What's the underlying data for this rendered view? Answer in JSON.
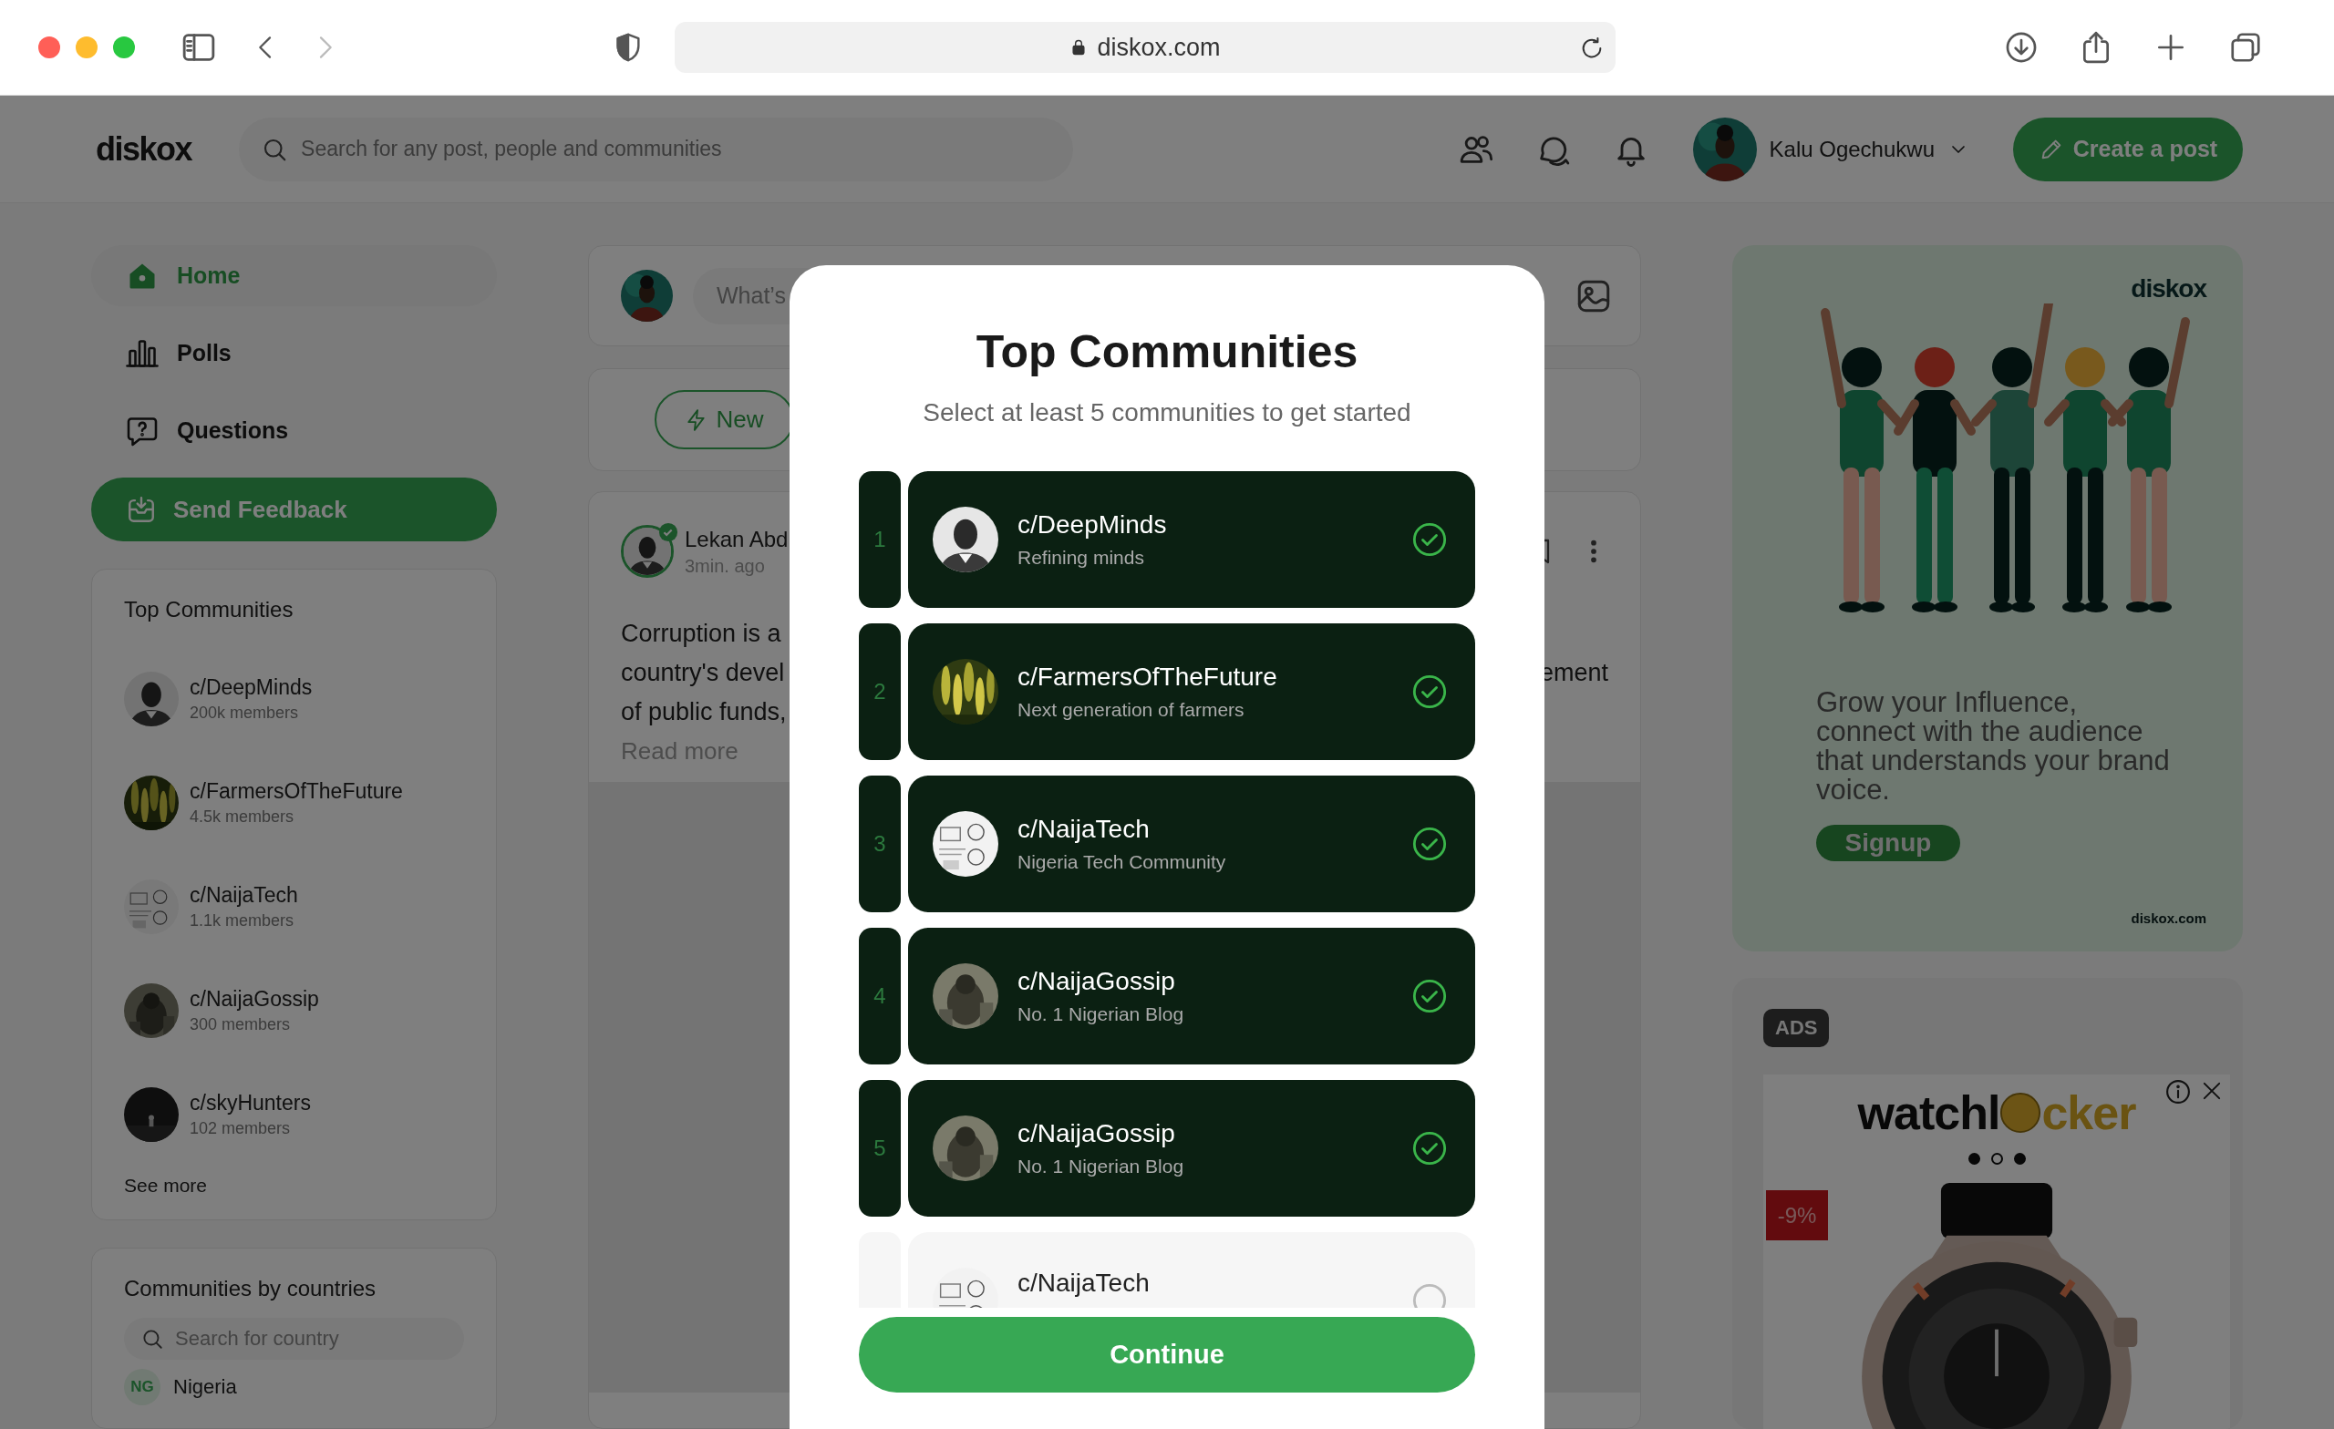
{
  "browser": {
    "url": "diskox.com"
  },
  "header": {
    "logo": "diskox",
    "search_placeholder": "Search for any post, people and communities",
    "user_name": "Kalu Ogechukwu",
    "create_button": "Create a post"
  },
  "sidebar": {
    "nav": [
      {
        "label": "Home",
        "selected": true
      },
      {
        "label": "Polls",
        "selected": false
      },
      {
        "label": "Questions",
        "selected": false
      }
    ],
    "feedback_button": "Send Feedback",
    "top_communities": {
      "title": "Top Communities",
      "items": [
        {
          "name": "c/DeepMinds",
          "members": "200k members"
        },
        {
          "name": "c/FarmersOfTheFuture",
          "members": "4.5k members"
        },
        {
          "name": "c/NaijaTech",
          "members": "1.1k members"
        },
        {
          "name": "c/NaijaGossip",
          "members": "300 members"
        },
        {
          "name": "c/skyHunters",
          "members": "102 members"
        }
      ],
      "see_more": "See more"
    },
    "countries": {
      "title": "Communities by countries",
      "search_placeholder": "Search for country",
      "items": [
        {
          "code": "NG",
          "name": "Nigeria"
        }
      ]
    }
  },
  "feed": {
    "composer_placeholder": "What’s",
    "filter_button": "New",
    "post": {
      "author": "Lekan Abd",
      "time": "3min. ago",
      "verified": true,
      "lines": [
        {
          "left": "Corruption is a"
        },
        {
          "left": "country's devel",
          "right": "ement"
        },
        {
          "left": "of public funds,"
        }
      ],
      "read_more": "Read more"
    }
  },
  "right": {
    "promo": {
      "logo": "diskox",
      "text": "Grow your Influence, connect with the audience that understands your brand voice.",
      "button": "Signup",
      "site": "diskox.com"
    },
    "ads": {
      "badge": "ADS",
      "logo_left": "watchl",
      "logo_right": "cker",
      "dots": [
        {
          "selected": false
        },
        {
          "selected": true
        },
        {
          "selected": false
        }
      ],
      "discount": "-9%"
    }
  },
  "modal": {
    "title": "Top Communities",
    "subtitle": "Select at least 5 communities to get started",
    "items": [
      {
        "number": "1",
        "name": "c/DeepMinds",
        "description": "Refining minds",
        "selected": true
      },
      {
        "number": "2",
        "name": "c/FarmersOfTheFuture",
        "description": "Next generation of farmers",
        "selected": true
      },
      {
        "number": "3",
        "name": "c/NaijaTech",
        "description": "Nigeria Tech Community",
        "selected": true
      },
      {
        "number": "4",
        "name": "c/NaijaGossip",
        "description": "No. 1 Nigerian Blog",
        "selected": true
      },
      {
        "number": "5",
        "name": "c/NaijaGossip",
        "description": "No. 1 Nigerian Blog",
        "selected": true
      },
      {
        "name": "c/NaijaTech",
        "selected": false
      }
    ],
    "continue_button": "Continue"
  }
}
